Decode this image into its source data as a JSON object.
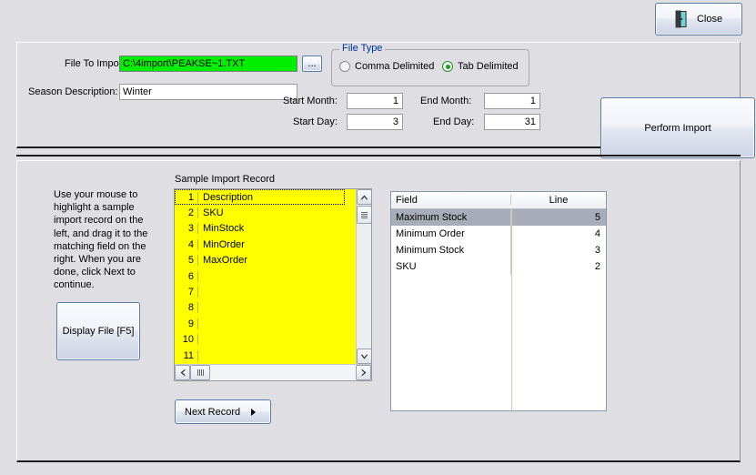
{
  "window": {
    "close_button": {
      "label": "Close",
      "icon": "door-exit-icon"
    }
  },
  "import_settings": {
    "file_to_import_label": "File To Import:",
    "file_to_import_value": "C:\\4import\\PEAKSE~1.TXT",
    "file_field_bg_color": "#00ee00",
    "browse_button_label": "...",
    "season_description_label": "Season Description:",
    "season_description_value": "Winter",
    "start_month_label": "Start Month:",
    "start_month_value": "1",
    "start_day_label": "Start Day:",
    "start_day_value": "3",
    "end_month_label": "End Month:",
    "end_month_value": "1",
    "end_day_label": "End Day:",
    "end_day_value": "31",
    "file_type": {
      "legend": "File Type",
      "legend_color": "#00339e",
      "options": [
        {
          "label": "Comma Delimited",
          "selected": false
        },
        {
          "label": "Tab Delimited",
          "selected": true
        }
      ]
    },
    "perform_import_label": "Perform Import"
  },
  "mapping": {
    "instructions": "Use your mouse to highlight a sample import record on the left, and drag it to the matching field on the right.  When you are done, click Next to continue.",
    "display_file_label": "Display File [F5]",
    "sample_title": "Sample Import Record",
    "sample_rows": [
      {
        "line": "1",
        "value": "Description",
        "focused": true
      },
      {
        "line": "2",
        "value": "SKU",
        "focused": false
      },
      {
        "line": "3",
        "value": "MinStock",
        "focused": false
      },
      {
        "line": "4",
        "value": "MinOrder",
        "focused": false
      },
      {
        "line": "5",
        "value": "MaxOrder",
        "focused": false
      },
      {
        "line": "6",
        "value": "",
        "focused": false
      },
      {
        "line": "7",
        "value": "",
        "focused": false
      },
      {
        "line": "8",
        "value": "",
        "focused": false
      },
      {
        "line": "9",
        "value": "",
        "focused": false
      },
      {
        "line": "10",
        "value": "",
        "focused": false
      },
      {
        "line": "11",
        "value": "",
        "focused": false
      }
    ],
    "sample_bg_color": "#ffff00",
    "next_record_label": "Next Record",
    "grid": {
      "columns": [
        "Field",
        "Line"
      ],
      "rows": [
        {
          "field": "Maximum Stock",
          "line": "5",
          "selected": true
        },
        {
          "field": "Minimum Order",
          "line": "4",
          "selected": false
        },
        {
          "field": "Minimum Stock",
          "line": "3",
          "selected": false
        },
        {
          "field": "SKU",
          "line": "2",
          "selected": false
        }
      ]
    }
  }
}
